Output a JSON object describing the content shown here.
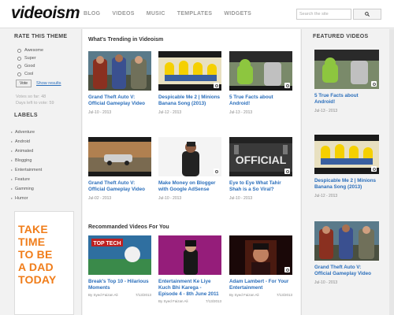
{
  "header": {
    "logo": "videoism",
    "nav": [
      "BLOG",
      "VIDEOS",
      "MUSIC",
      "TEMPLATES",
      "WIDGETS"
    ],
    "search_placeholder": "Search the site"
  },
  "left_sidebar": {
    "poll_title": "RATE THIS THEME",
    "poll_options": [
      "Awesome",
      "Super",
      "Good",
      "Cool"
    ],
    "vote_label": "Vote",
    "show_results_label": "Show results",
    "votes_so_far": "Votes so far: 48",
    "days_left": "Days left to vote: 59",
    "labels_title": "LABELS",
    "labels": [
      "Adventure",
      "Android",
      "Animated",
      "Blogging",
      "Entertainment",
      "Feature",
      "Gamming",
      "Humor"
    ],
    "ad_lines": [
      "TAKE",
      "TIME",
      "TO BE",
      "A DAD",
      "TODAY"
    ]
  },
  "main": {
    "trending_title": "What's Trending in Videoism",
    "recommended_title": "Recommanded Videos For You",
    "trending": [
      {
        "title": "Grand Theft Auto V: Official Gameplay Video",
        "date": "Jul-10 - 2013",
        "thumb": "gta"
      },
      {
        "title": "Despicable Me 2 | Minions Banana Song (2013)",
        "date": "Jul-12 - 2013",
        "thumb": "minions"
      },
      {
        "title": "5 True Facts about Android!",
        "date": "Jul-13 - 2013",
        "thumb": "android"
      },
      {
        "title": "Grand Theft Auto V: Official Gameplay Video",
        "date": "Jul-02 - 2013",
        "thumb": "gta2"
      },
      {
        "title": "Make Money on Blogger with Google AdSense",
        "date": "Jul-10 - 2013",
        "thumb": "blogger"
      },
      {
        "title": "Eye to Eye What Tahir Shah is a So Viral?",
        "date": "Jul-10 - 2013",
        "thumb": "official"
      }
    ],
    "recommended": [
      {
        "title": "Break's Top 10 - Hilarious Moments",
        "author": "By Syed Faizan Ali",
        "date": "7/13/2013",
        "thumb": "toptech"
      },
      {
        "title": "Entertainment Ke Liye Kuch Bhi Karega - Episode 4 - 8th June 2011",
        "author": "By Syed Faizan Ali",
        "date": "7/13/2013",
        "thumb": "show"
      },
      {
        "title": "Adam Lambert - For Your Entertainment",
        "author": "By Syed Faizan Ali",
        "date": "7/13/2013",
        "thumb": "lambert"
      }
    ]
  },
  "right_sidebar": {
    "featured_title": "FEATURED VIDEOS",
    "featured": [
      {
        "title": "5 True Facts about Android!",
        "date": "Jul-13 - 2013",
        "thumb": "android"
      },
      {
        "title": "Despicable Me 2 | Minions Banana Song (2013)",
        "date": "Jul-12 - 2013",
        "thumb": "minions"
      },
      {
        "title": "Grand Theft Auto V: Official Gameplay Video",
        "date": "Jul-10 - 2013",
        "thumb": "gta"
      }
    ]
  },
  "colors": {
    "link": "#2a6ebb",
    "ad_orange": "#f07d1a",
    "logo": "#111111"
  }
}
